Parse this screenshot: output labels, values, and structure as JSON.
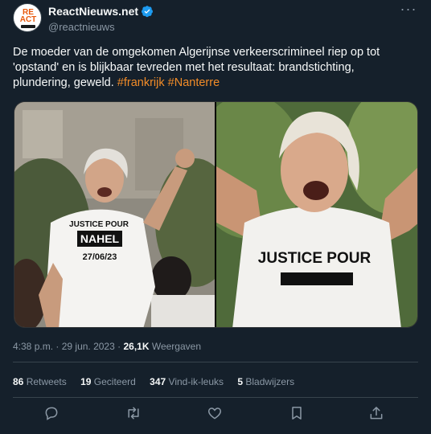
{
  "author": {
    "avatar_line1": "RE",
    "avatar_line2": "ACT",
    "display_name": "ReactNieuws.net",
    "handle": "@reactnieuws"
  },
  "tweet": {
    "text_main": "De moeder van de omgekomen Algerijnse verkeerscrimineel riep op tot 'opstand' en is blijkbaar tevreden met het resultaat: brandstichting, plundering, geweld.",
    "hashtag_1": "#frankrijk",
    "hashtag_2": "#Nanterre"
  },
  "media": {
    "left_shirt_line1": "JUSTICE POUR",
    "left_shirt_line2": "NAHEL",
    "left_shirt_line3": "27/06/23",
    "right_shirt_line1": "JUSTICE POUR"
  },
  "meta": {
    "time": "4:38 p.m.",
    "separator": "·",
    "date": "29 jun. 2023",
    "views_count": "26,1K",
    "views_label": "Weergaven"
  },
  "stats": {
    "retweets_count": "86",
    "retweets_label": "Retweets",
    "quotes_count": "19",
    "quotes_label": "Geciteerd",
    "likes_count": "347",
    "likes_label": "Vind-ik-leuks",
    "bookmarks_count": "5",
    "bookmarks_label": "Bladwijzers"
  },
  "colors": {
    "background": "#15202b",
    "text": "#f7f9f9",
    "secondary": "#8b98a5",
    "hashtag": "#f28c28",
    "verified": "#1d9bf0"
  },
  "icons": {
    "verified": "verified-badge-icon",
    "more": "more-options-icon",
    "reply": "reply-icon",
    "retweet": "retweet-icon",
    "like": "like-icon",
    "bookmark": "bookmark-icon",
    "share": "share-icon"
  }
}
